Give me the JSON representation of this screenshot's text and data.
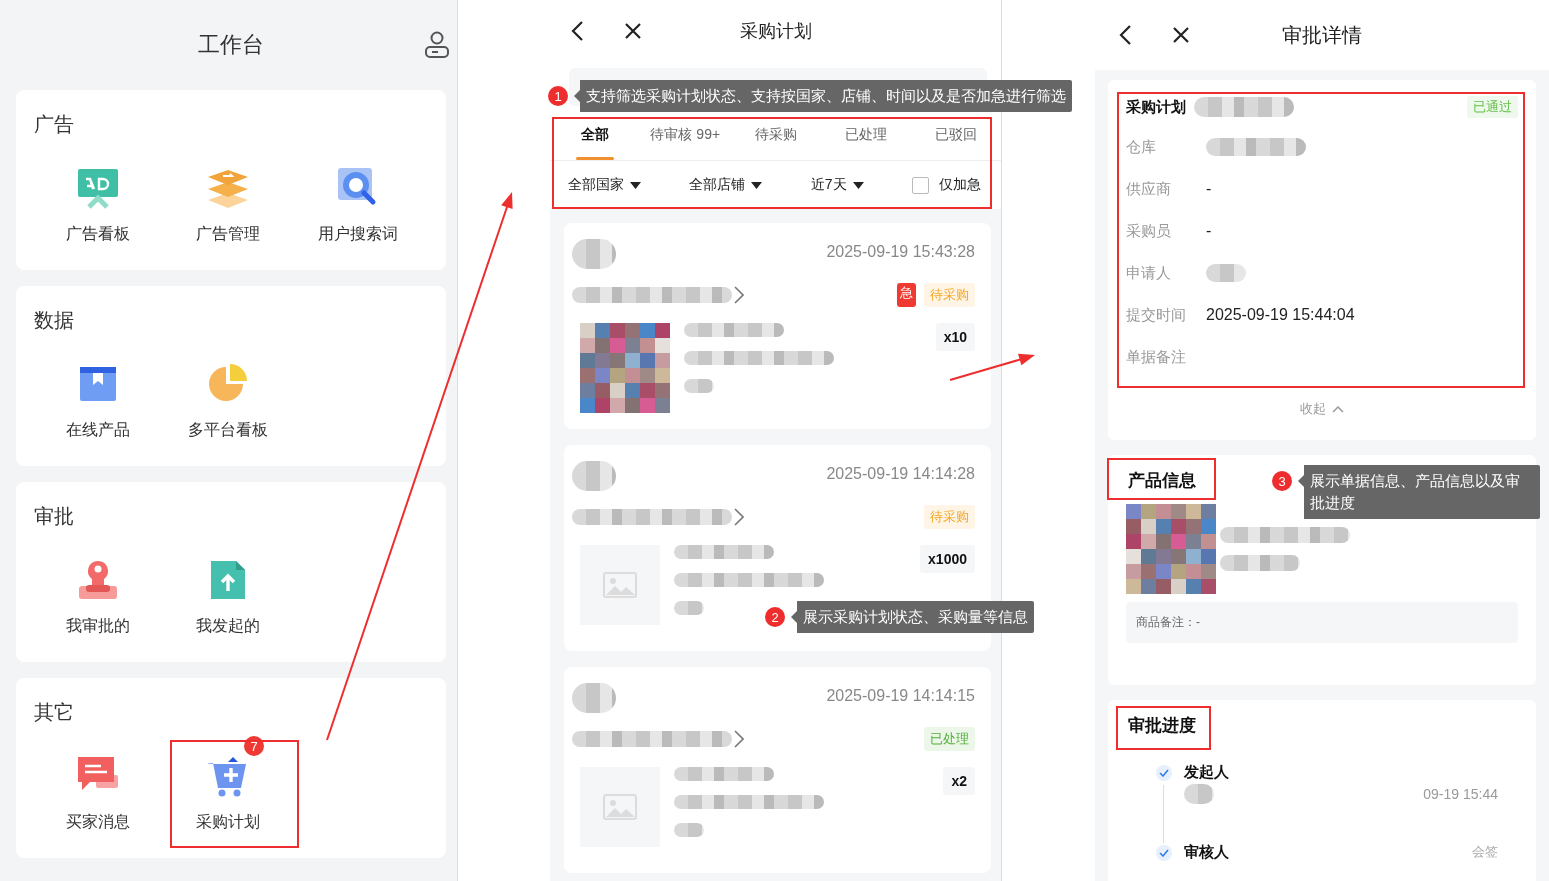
{
  "workbench": {
    "title": "工作台",
    "sections": [
      {
        "title": "广告",
        "items": [
          {
            "label": "广告看板"
          },
          {
            "label": "广告管理"
          },
          {
            "label": "用户搜索词"
          }
        ]
      },
      {
        "title": "数据",
        "items": [
          {
            "label": "在线产品"
          },
          {
            "label": "多平台看板"
          }
        ]
      },
      {
        "title": "审批",
        "items": [
          {
            "label": "我审批的"
          },
          {
            "label": "我发起的"
          }
        ]
      },
      {
        "title": "其它",
        "items": [
          {
            "label": "买家消息"
          },
          {
            "label": "采购计划",
            "badge": "7"
          }
        ]
      }
    ]
  },
  "purchase_list": {
    "title": "采购计划",
    "tabs": [
      {
        "label": "全部",
        "selected": true
      },
      {
        "label": "待审核 99+",
        "selected": false
      },
      {
        "label": "待采购",
        "selected": false
      },
      {
        "label": "已处理",
        "selected": false
      },
      {
        "label": "已驳回",
        "selected": false
      }
    ],
    "filters": [
      {
        "kind": "dropdown",
        "label": "全部国家"
      },
      {
        "kind": "dropdown",
        "label": "全部店铺"
      },
      {
        "kind": "dropdown",
        "label": "近7天"
      },
      {
        "kind": "checkbox",
        "label": "仅加急",
        "checked": false
      }
    ],
    "orders": [
      {
        "kind": "photo",
        "time": "2025-09-19 15:43:28",
        "urgent_tag": "急",
        "status": "待采购",
        "color": "#f5a623",
        "quantity": "x10"
      },
      {
        "kind": "placeholder",
        "time": "2025-09-19 14:14:28",
        "status": "待采购",
        "color": "#f5a623",
        "quantity": "x1000"
      },
      {
        "kind": "placeholder",
        "time": "2025-09-19 14:14:15",
        "status": "已处理",
        "color": "#52b03a",
        "quantity": "x2"
      }
    ]
  },
  "approval_detail": {
    "title": "审批详情",
    "plan_label": "采购计划",
    "status": "已通过",
    "fields": [
      {
        "label": "仓库",
        "kind": "redacted"
      },
      {
        "label": "供应商",
        "kind": "text",
        "value": "-"
      },
      {
        "label": "采购员",
        "kind": "text",
        "value": "-"
      },
      {
        "label": "申请人",
        "kind": "redacted"
      },
      {
        "label": "提交时间",
        "kind": "text",
        "value": "2025-09-19 15:44:04"
      },
      {
        "label": "单据备注",
        "kind": "text"
      }
    ],
    "collapse": "收起",
    "product_title": "产品信息",
    "product_note": "商品备注：-",
    "progress_title": "审批进度",
    "steps": [
      {
        "label": "发起人",
        "done": true,
        "time": "09-19 15:44"
      },
      {
        "label": "审核人",
        "done": true,
        "tag": "会签"
      }
    ]
  },
  "annotations": [
    {
      "number": "1",
      "text": "支持筛选采购计划状态、支持按国家、店铺、时间以及是否加急进行筛选"
    },
    {
      "number": "2",
      "text": "展示采购计划状态、采购量等信息"
    },
    {
      "number": "3",
      "text": "展示单据信息、产品信息以及审批进度"
    }
  ]
}
